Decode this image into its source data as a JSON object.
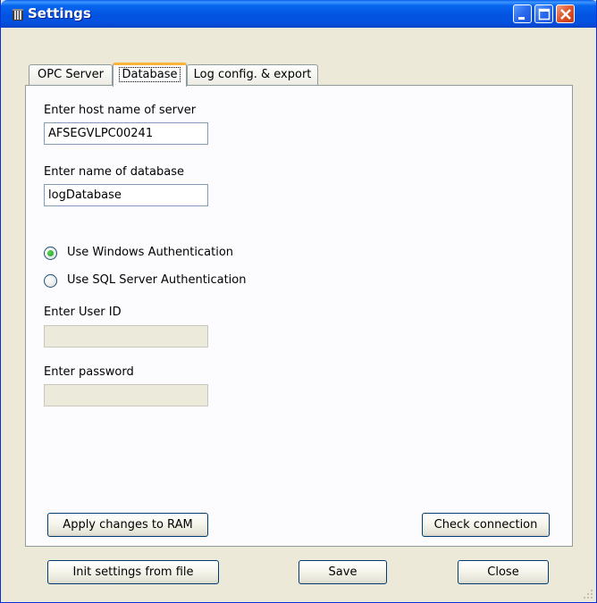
{
  "window": {
    "title": "Settings",
    "icon": "app-icon",
    "controls": [
      "minimize-icon",
      "maximize-icon",
      "close-icon"
    ]
  },
  "tabs": [
    {
      "label": "OPC Server",
      "active": false
    },
    {
      "label": "Database",
      "active": true
    },
    {
      "label": "Log config. & export",
      "active": false
    }
  ],
  "database": {
    "host_label": "Enter host name of server",
    "host_value": "AFSEGVLPC00241",
    "db_label": "Enter name of database",
    "db_value": "logDatabase",
    "auth_options": [
      {
        "label": "Use Windows Authentication",
        "selected": true
      },
      {
        "label": "Use SQL Server Authentication",
        "selected": false
      }
    ],
    "user_label": "Enter User ID",
    "user_value": "",
    "password_label": "Enter password",
    "password_value": "",
    "apply_label": "Apply changes to RAM",
    "check_label": "Check connection"
  },
  "footer": {
    "init_label": "Init settings from file",
    "save_label": "Save",
    "close_label": "Close"
  },
  "colors": {
    "titlebar": "#0353e1",
    "window_bg": "#ece9d8",
    "tab_highlight": "#f8b33a",
    "radio_selected": "#21a121"
  }
}
